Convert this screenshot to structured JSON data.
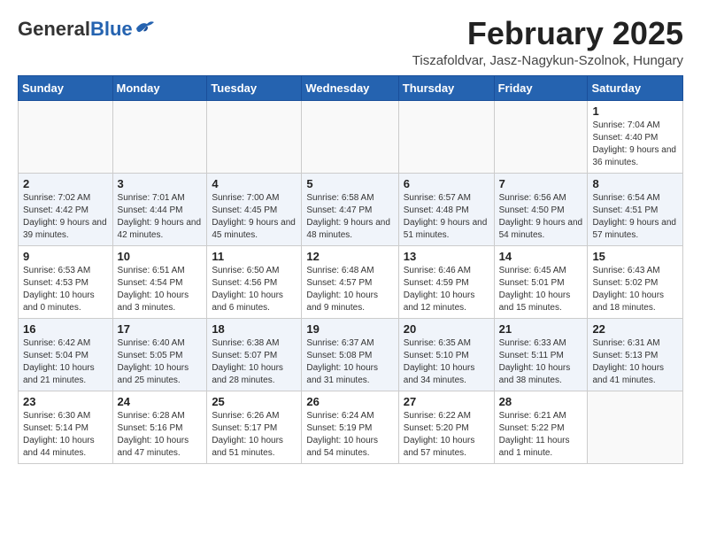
{
  "header": {
    "logo_general": "General",
    "logo_blue": "Blue",
    "month_year": "February 2025",
    "location": "Tiszafoldvar, Jasz-Nagykun-Szolnok, Hungary"
  },
  "weekdays": [
    "Sunday",
    "Monday",
    "Tuesday",
    "Wednesday",
    "Thursday",
    "Friday",
    "Saturday"
  ],
  "weeks": [
    [
      {
        "day": "",
        "info": ""
      },
      {
        "day": "",
        "info": ""
      },
      {
        "day": "",
        "info": ""
      },
      {
        "day": "",
        "info": ""
      },
      {
        "day": "",
        "info": ""
      },
      {
        "day": "",
        "info": ""
      },
      {
        "day": "1",
        "info": "Sunrise: 7:04 AM\nSunset: 4:40 PM\nDaylight: 9 hours and 36 minutes."
      }
    ],
    [
      {
        "day": "2",
        "info": "Sunrise: 7:02 AM\nSunset: 4:42 PM\nDaylight: 9 hours and 39 minutes."
      },
      {
        "day": "3",
        "info": "Sunrise: 7:01 AM\nSunset: 4:44 PM\nDaylight: 9 hours and 42 minutes."
      },
      {
        "day": "4",
        "info": "Sunrise: 7:00 AM\nSunset: 4:45 PM\nDaylight: 9 hours and 45 minutes."
      },
      {
        "day": "5",
        "info": "Sunrise: 6:58 AM\nSunset: 4:47 PM\nDaylight: 9 hours and 48 minutes."
      },
      {
        "day": "6",
        "info": "Sunrise: 6:57 AM\nSunset: 4:48 PM\nDaylight: 9 hours and 51 minutes."
      },
      {
        "day": "7",
        "info": "Sunrise: 6:56 AM\nSunset: 4:50 PM\nDaylight: 9 hours and 54 minutes."
      },
      {
        "day": "8",
        "info": "Sunrise: 6:54 AM\nSunset: 4:51 PM\nDaylight: 9 hours and 57 minutes."
      }
    ],
    [
      {
        "day": "9",
        "info": "Sunrise: 6:53 AM\nSunset: 4:53 PM\nDaylight: 10 hours and 0 minutes."
      },
      {
        "day": "10",
        "info": "Sunrise: 6:51 AM\nSunset: 4:54 PM\nDaylight: 10 hours and 3 minutes."
      },
      {
        "day": "11",
        "info": "Sunrise: 6:50 AM\nSunset: 4:56 PM\nDaylight: 10 hours and 6 minutes."
      },
      {
        "day": "12",
        "info": "Sunrise: 6:48 AM\nSunset: 4:57 PM\nDaylight: 10 hours and 9 minutes."
      },
      {
        "day": "13",
        "info": "Sunrise: 6:46 AM\nSunset: 4:59 PM\nDaylight: 10 hours and 12 minutes."
      },
      {
        "day": "14",
        "info": "Sunrise: 6:45 AM\nSunset: 5:01 PM\nDaylight: 10 hours and 15 minutes."
      },
      {
        "day": "15",
        "info": "Sunrise: 6:43 AM\nSunset: 5:02 PM\nDaylight: 10 hours and 18 minutes."
      }
    ],
    [
      {
        "day": "16",
        "info": "Sunrise: 6:42 AM\nSunset: 5:04 PM\nDaylight: 10 hours and 21 minutes."
      },
      {
        "day": "17",
        "info": "Sunrise: 6:40 AM\nSunset: 5:05 PM\nDaylight: 10 hours and 25 minutes."
      },
      {
        "day": "18",
        "info": "Sunrise: 6:38 AM\nSunset: 5:07 PM\nDaylight: 10 hours and 28 minutes."
      },
      {
        "day": "19",
        "info": "Sunrise: 6:37 AM\nSunset: 5:08 PM\nDaylight: 10 hours and 31 minutes."
      },
      {
        "day": "20",
        "info": "Sunrise: 6:35 AM\nSunset: 5:10 PM\nDaylight: 10 hours and 34 minutes."
      },
      {
        "day": "21",
        "info": "Sunrise: 6:33 AM\nSunset: 5:11 PM\nDaylight: 10 hours and 38 minutes."
      },
      {
        "day": "22",
        "info": "Sunrise: 6:31 AM\nSunset: 5:13 PM\nDaylight: 10 hours and 41 minutes."
      }
    ],
    [
      {
        "day": "23",
        "info": "Sunrise: 6:30 AM\nSunset: 5:14 PM\nDaylight: 10 hours and 44 minutes."
      },
      {
        "day": "24",
        "info": "Sunrise: 6:28 AM\nSunset: 5:16 PM\nDaylight: 10 hours and 47 minutes."
      },
      {
        "day": "25",
        "info": "Sunrise: 6:26 AM\nSunset: 5:17 PM\nDaylight: 10 hours and 51 minutes."
      },
      {
        "day": "26",
        "info": "Sunrise: 6:24 AM\nSunset: 5:19 PM\nDaylight: 10 hours and 54 minutes."
      },
      {
        "day": "27",
        "info": "Sunrise: 6:22 AM\nSunset: 5:20 PM\nDaylight: 10 hours and 57 minutes."
      },
      {
        "day": "28",
        "info": "Sunrise: 6:21 AM\nSunset: 5:22 PM\nDaylight: 11 hours and 1 minute."
      },
      {
        "day": "",
        "info": ""
      }
    ]
  ]
}
